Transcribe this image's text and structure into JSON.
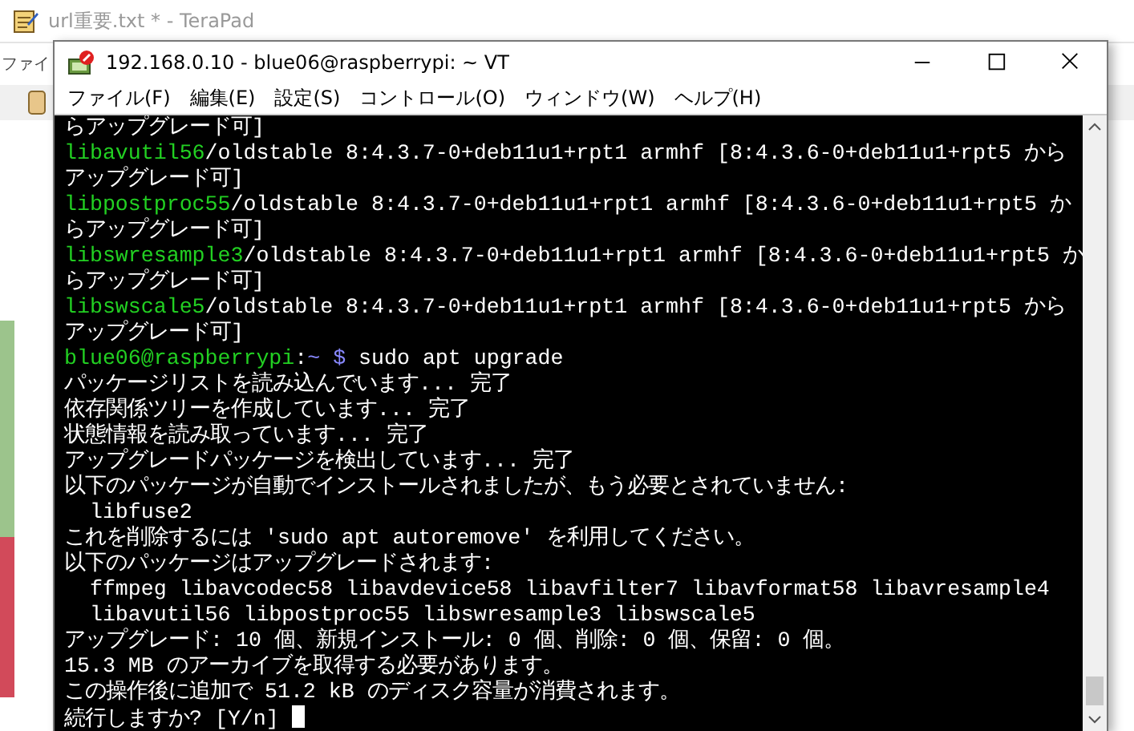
{
  "background_window": {
    "title": "url重要.txt * - TeraPad",
    "menu": [
      "ファイ"
    ]
  },
  "window": {
    "title": "192.168.0.10 - blue06@raspberrypi: ~ VT"
  },
  "menu": [
    "ファイル(F)",
    "編集(E)",
    "設定(S)",
    "コントロール(O)",
    "ウィンドウ(W)",
    "ヘルプ(H)"
  ],
  "terminal": {
    "lines": [
      [
        {
          "kind": "plain",
          "text": "らアップグレード可]"
        }
      ],
      [
        {
          "kind": "highlight",
          "text": "libavutil56"
        },
        {
          "kind": "plain",
          "text": "/oldstable 8:4.3.7-0+deb11u1+rpt1 armhf [8:4.3.6-0+deb11u1+rpt5 から"
        }
      ],
      [
        {
          "kind": "plain",
          "text": "アップグレード可]"
        }
      ],
      [
        {
          "kind": "highlight",
          "text": "libpostproc55"
        },
        {
          "kind": "plain",
          "text": "/oldstable 8:4.3.7-0+deb11u1+rpt1 armhf [8:4.3.6-0+deb11u1+rpt5 か"
        }
      ],
      [
        {
          "kind": "plain",
          "text": "らアップグレード可]"
        }
      ],
      [
        {
          "kind": "highlight",
          "text": "libswresample3"
        },
        {
          "kind": "plain",
          "text": "/oldstable 8:4.3.7-0+deb11u1+rpt1 armhf [8:4.3.6-0+deb11u1+rpt5 か"
        }
      ],
      [
        {
          "kind": "plain",
          "text": "らアップグレード可]"
        }
      ],
      [
        {
          "kind": "highlight",
          "text": "libswscale5"
        },
        {
          "kind": "plain",
          "text": "/oldstable 8:4.3.7-0+deb11u1+rpt1 armhf [8:4.3.6-0+deb11u1+rpt5 から"
        }
      ],
      [
        {
          "kind": "plain",
          "text": "アップグレード可]"
        }
      ],
      [
        {
          "kind": "highlight",
          "text": "blue06@raspberrypi"
        },
        {
          "kind": "plain",
          "text": ":"
        },
        {
          "kind": "path",
          "text": "~ $"
        },
        {
          "kind": "plain",
          "text": " sudo apt upgrade"
        }
      ],
      [
        {
          "kind": "plain",
          "text": "パッケージリストを読み込んでいます... 完了"
        }
      ],
      [
        {
          "kind": "plain",
          "text": "依存関係ツリーを作成しています... 完了"
        }
      ],
      [
        {
          "kind": "plain",
          "text": "状態情報を読み取っています... 完了"
        }
      ],
      [
        {
          "kind": "plain",
          "text": "アップグレードパッケージを検出しています... 完了"
        }
      ],
      [
        {
          "kind": "plain",
          "text": "以下のパッケージが自動でインストールされましたが、もう必要とされていません:"
        }
      ],
      [
        {
          "kind": "plain",
          "text": "  libfuse2"
        }
      ],
      [
        {
          "kind": "plain",
          "text": "これを削除するには 'sudo apt autoremove' を利用してください。"
        }
      ],
      [
        {
          "kind": "plain",
          "text": "以下のパッケージはアップグレードされます:"
        }
      ],
      [
        {
          "kind": "plain",
          "text": "  ffmpeg libavcodec58 libavdevice58 libavfilter7 libavformat58 libavresample4"
        }
      ],
      [
        {
          "kind": "plain",
          "text": "  libavutil56 libpostproc55 libswresample3 libswscale5"
        }
      ],
      [
        {
          "kind": "plain",
          "text": "アップグレード: 10 個、新規インストール: 0 個、削除: 0 個、保留: 0 個。"
        }
      ],
      [
        {
          "kind": "plain",
          "text": "15.3 MB のアーカイブを取得する必要があります。"
        }
      ],
      [
        {
          "kind": "plain",
          "text": "この操作後に追加で 51.2 kB のディスク容量が消費されます。"
        }
      ],
      [
        {
          "kind": "plain",
          "text": "続行しますか? [Y/n] "
        }
      ]
    ],
    "cursor": true
  }
}
